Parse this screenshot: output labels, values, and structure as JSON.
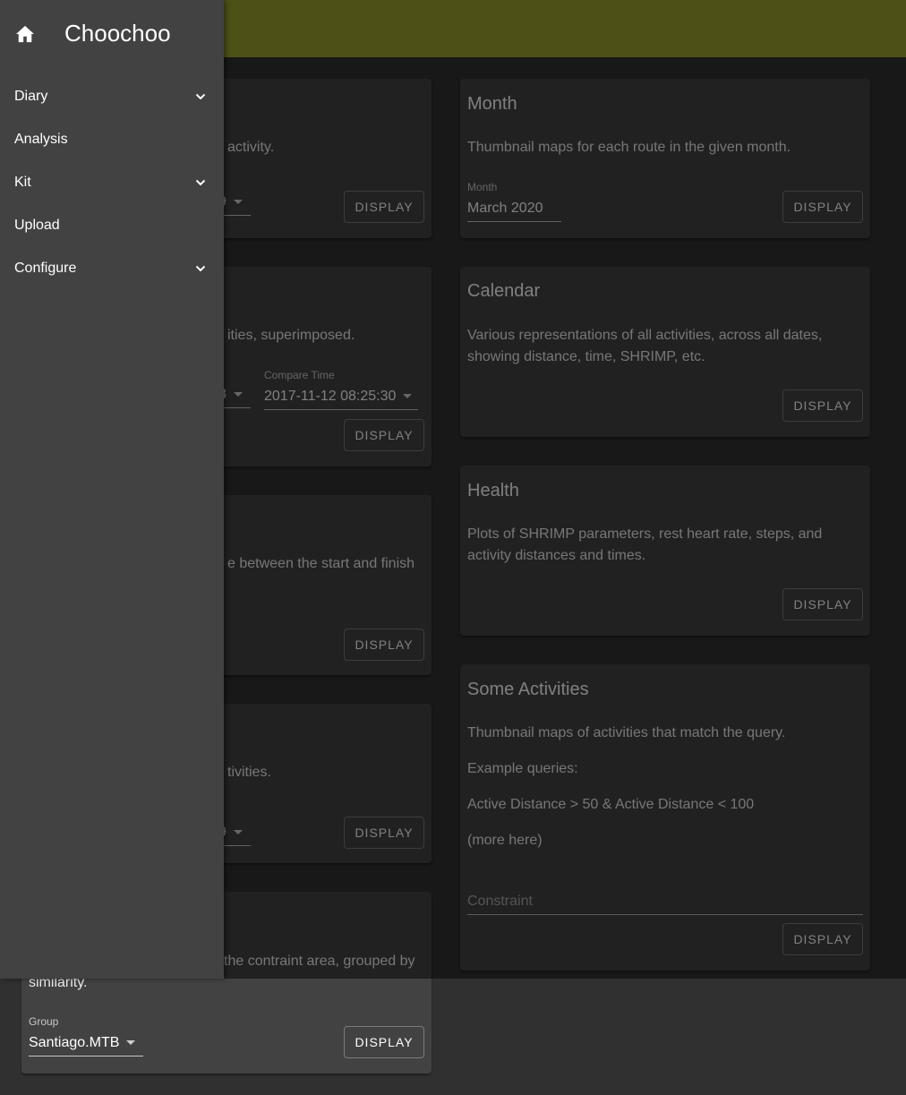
{
  "app": {
    "title": "Choochoo"
  },
  "nav": {
    "items": [
      {
        "label": "Diary",
        "expandable": true
      },
      {
        "label": "Analysis",
        "expandable": false
      },
      {
        "label": "Kit",
        "expandable": true
      },
      {
        "label": "Upload",
        "expandable": false
      },
      {
        "label": "Configure",
        "expandable": true
      }
    ]
  },
  "cards_left": {
    "c1": {
      "text_visible": "activity.",
      "date_fragment": "9",
      "button": "DISPLAY"
    },
    "c2": {
      "text_visible": "ities, superimposed.",
      "date_fragment": "8",
      "compare_label": "Compare Time",
      "compare_value": "2017-11-12 08:25:30",
      "button": "DISPLAY"
    },
    "c3": {
      "text_visible": "e between the start and finish",
      "button": "DISPLAY"
    },
    "c4": {
      "text_visible": "tivities.",
      "date_fragment": "9",
      "button": "DISPLAY"
    },
    "c5": {
      "text_line1": "the contraint area, grouped by",
      "text_line2": "similarity.",
      "group_label": "Group",
      "group_value": "Santiago.MTB",
      "button": "DISPLAY"
    }
  },
  "cards_right": {
    "month": {
      "title": "Month",
      "text": "Thumbnail maps for each route in the given month.",
      "field_label": "Month",
      "field_value": "March 2020",
      "button": "DISPLAY"
    },
    "calendar": {
      "title": "Calendar",
      "text_line1": "Various representations of all activities, across all dates,",
      "text_line2": "showing distance, time, SHRIMP, etc.",
      "button": "DISPLAY"
    },
    "health": {
      "title": "Health",
      "text_line1": "Plots of SHRIMP parameters, rest heart rate, steps, and",
      "text_line2": "activity distances and times.",
      "button": "DISPLAY"
    },
    "some": {
      "title": "Some Activities",
      "text": "Thumbnail maps of activities that match the query.",
      "example_heading": "Example queries:",
      "example": "Active Distance > 50 & Active Distance < 100",
      "more": "(more here)",
      "placeholder": "Constraint",
      "button": "DISPLAY"
    }
  },
  "colors": {
    "appbar": "#9aa22e",
    "background": "#303030",
    "card": "#424242"
  }
}
